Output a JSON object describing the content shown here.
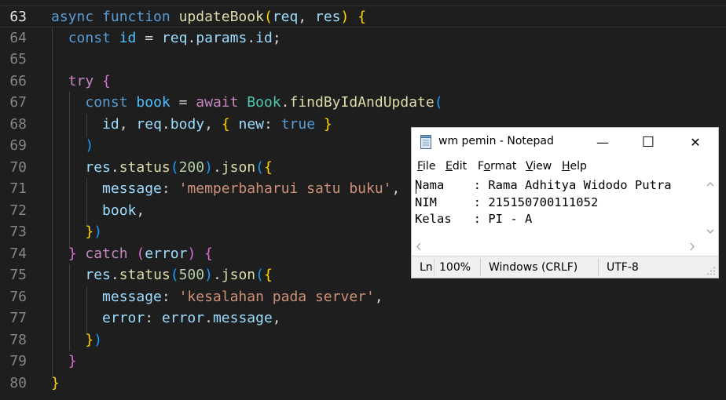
{
  "editor": {
    "lines": [
      {
        "n": "63",
        "tokens": [
          [
            "kw",
            "async "
          ],
          [
            "kw",
            "function "
          ],
          [
            "fn",
            "updateBook"
          ],
          [
            "b1",
            "("
          ],
          [
            "var",
            "req"
          ],
          [
            "txt",
            ", "
          ],
          [
            "var",
            "res"
          ],
          [
            "b1",
            ")"
          ],
          [
            "txt",
            " "
          ],
          [
            "b1",
            "{"
          ]
        ]
      },
      {
        "n": "64",
        "tokens": [
          [
            "txt",
            "  "
          ],
          [
            "kw",
            "const "
          ],
          [
            "const",
            "id"
          ],
          [
            "txt",
            " = "
          ],
          [
            "var",
            "req"
          ],
          [
            "txt",
            "."
          ],
          [
            "var",
            "params"
          ],
          [
            "txt",
            "."
          ],
          [
            "var",
            "id"
          ],
          [
            "txt",
            ";"
          ]
        ]
      },
      {
        "n": "65",
        "tokens": []
      },
      {
        "n": "66",
        "tokens": [
          [
            "txt",
            "  "
          ],
          [
            "ctrl",
            "try "
          ],
          [
            "b2",
            "{"
          ]
        ]
      },
      {
        "n": "67",
        "tokens": [
          [
            "txt",
            "    "
          ],
          [
            "kw",
            "const "
          ],
          [
            "const",
            "book"
          ],
          [
            "txt",
            " = "
          ],
          [
            "ctrl",
            "await "
          ],
          [
            "cls",
            "Book"
          ],
          [
            "txt",
            "."
          ],
          [
            "fn",
            "findByIdAndUpdate"
          ],
          [
            "b3",
            "("
          ]
        ]
      },
      {
        "n": "68",
        "tokens": [
          [
            "txt",
            "      "
          ],
          [
            "var",
            "id"
          ],
          [
            "txt",
            ", "
          ],
          [
            "var",
            "req"
          ],
          [
            "txt",
            "."
          ],
          [
            "var",
            "body"
          ],
          [
            "txt",
            ", "
          ],
          [
            "b1",
            "{"
          ],
          [
            "txt",
            " "
          ],
          [
            "var",
            "new"
          ],
          [
            "txt",
            ": "
          ],
          [
            "kw",
            "true"
          ],
          [
            "txt",
            " "
          ],
          [
            "b1",
            "}"
          ]
        ]
      },
      {
        "n": "69",
        "tokens": [
          [
            "txt",
            "    "
          ],
          [
            "b3",
            ")"
          ]
        ]
      },
      {
        "n": "70",
        "tokens": [
          [
            "txt",
            "    "
          ],
          [
            "var",
            "res"
          ],
          [
            "txt",
            "."
          ],
          [
            "fn",
            "status"
          ],
          [
            "b3",
            "("
          ],
          [
            "num",
            "200"
          ],
          [
            "b3",
            ")"
          ],
          [
            "txt",
            "."
          ],
          [
            "fn",
            "json"
          ],
          [
            "b3",
            "("
          ],
          [
            "b1",
            "{"
          ]
        ]
      },
      {
        "n": "71",
        "tokens": [
          [
            "txt",
            "      "
          ],
          [
            "var",
            "message"
          ],
          [
            "txt",
            ": "
          ],
          [
            "str",
            "'memperbaharui satu buku'"
          ],
          [
            "txt",
            ","
          ]
        ]
      },
      {
        "n": "72",
        "tokens": [
          [
            "txt",
            "      "
          ],
          [
            "var",
            "book"
          ],
          [
            "txt",
            ","
          ]
        ]
      },
      {
        "n": "73",
        "tokens": [
          [
            "txt",
            "    "
          ],
          [
            "b1",
            "}"
          ],
          [
            "b3",
            ")"
          ]
        ]
      },
      {
        "n": "74",
        "tokens": [
          [
            "txt",
            "  "
          ],
          [
            "b2",
            "}"
          ],
          [
            "txt",
            " "
          ],
          [
            "ctrl",
            "catch "
          ],
          [
            "b2",
            "("
          ],
          [
            "var",
            "error"
          ],
          [
            "b2",
            ")"
          ],
          [
            "txt",
            " "
          ],
          [
            "b2",
            "{"
          ]
        ]
      },
      {
        "n": "75",
        "tokens": [
          [
            "txt",
            "    "
          ],
          [
            "var",
            "res"
          ],
          [
            "txt",
            "."
          ],
          [
            "fn",
            "status"
          ],
          [
            "b3",
            "("
          ],
          [
            "num",
            "500"
          ],
          [
            "b3",
            ")"
          ],
          [
            "txt",
            "."
          ],
          [
            "fn",
            "json"
          ],
          [
            "b3",
            "("
          ],
          [
            "b1",
            "{"
          ]
        ]
      },
      {
        "n": "76",
        "tokens": [
          [
            "txt",
            "      "
          ],
          [
            "var",
            "message"
          ],
          [
            "txt",
            ": "
          ],
          [
            "str",
            "'kesalahan pada server'"
          ],
          [
            "txt",
            ","
          ]
        ]
      },
      {
        "n": "77",
        "tokens": [
          [
            "txt",
            "      "
          ],
          [
            "var",
            "error"
          ],
          [
            "txt",
            ": "
          ],
          [
            "var",
            "error"
          ],
          [
            "txt",
            "."
          ],
          [
            "var",
            "message"
          ],
          [
            "txt",
            ","
          ]
        ]
      },
      {
        "n": "78",
        "tokens": [
          [
            "txt",
            "    "
          ],
          [
            "b1",
            "}"
          ],
          [
            "b3",
            ")"
          ]
        ]
      },
      {
        "n": "79",
        "tokens": [
          [
            "txt",
            "  "
          ],
          [
            "b2",
            "}"
          ]
        ]
      },
      {
        "n": "80",
        "tokens": [
          [
            "b1",
            "}"
          ]
        ]
      }
    ],
    "active_line": "63"
  },
  "notepad": {
    "title": "wm pemin - Notepad",
    "icon": "notepad-icon",
    "controls": {
      "minimize": "—",
      "maximize": "☐",
      "close": "✕"
    },
    "menu": [
      {
        "accel": "F",
        "rest": "ile"
      },
      {
        "accel": "E",
        "rest": "dit"
      },
      {
        "pre": "F",
        "accel": "o",
        "rest": "rmat"
      },
      {
        "accel": "V",
        "rest": "iew"
      },
      {
        "accel": "H",
        "rest": "elp"
      }
    ],
    "content": "Nama    : Rama Adhitya Widodo Putra\nNIM     : 215150700111052\nKelas   : PI - A",
    "status": {
      "position": "Ln",
      "zoom": "100%",
      "line_ending": "Windows (CRLF)",
      "encoding": "UTF-8"
    }
  }
}
